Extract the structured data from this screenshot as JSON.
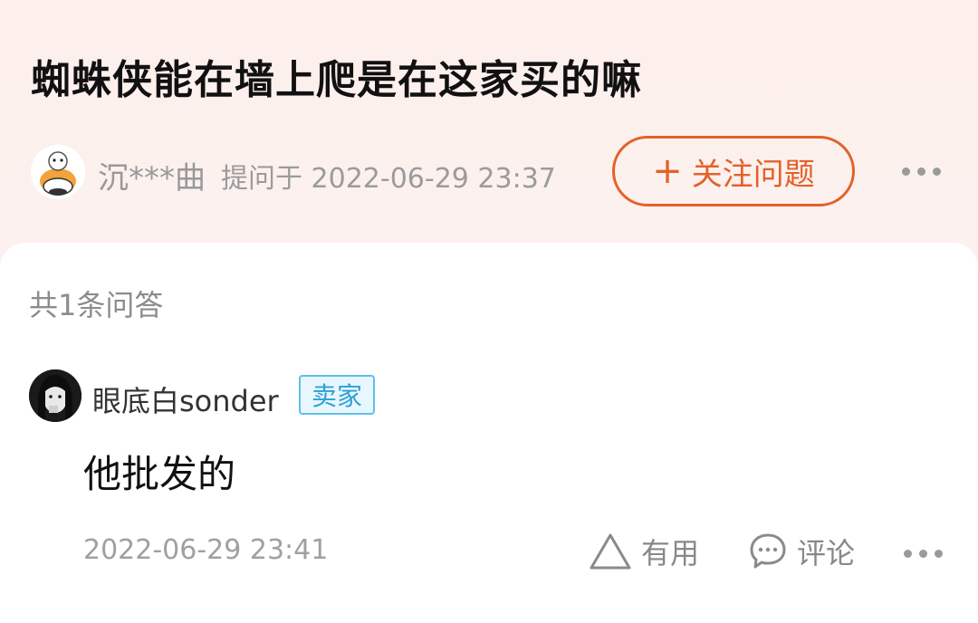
{
  "question": {
    "title": "蜘蛛侠能在墙上爬是在这家买的嘛",
    "asker_name": "沉***曲",
    "asked_meta": "提问于 2022-06-29 23:37",
    "follow_button": "关注问题",
    "follow_plus": "+"
  },
  "answers": {
    "count_label": "共1条问答",
    "items": [
      {
        "user_name": "眼底白sonder",
        "badge": "卖家",
        "text": "他批发的",
        "time": "2022-06-29 23:41",
        "useful_label": "有用",
        "comment_label": "评论"
      }
    ]
  },
  "colors": {
    "accent": "#e4612a",
    "badge_border": "#5cc0e8",
    "badge_text": "#2aa1d6",
    "header_bg": "#fdf1ee"
  },
  "icons": [
    "more-icon",
    "triangle-useful-icon",
    "comment-bubble-icon",
    "plus-icon"
  ]
}
